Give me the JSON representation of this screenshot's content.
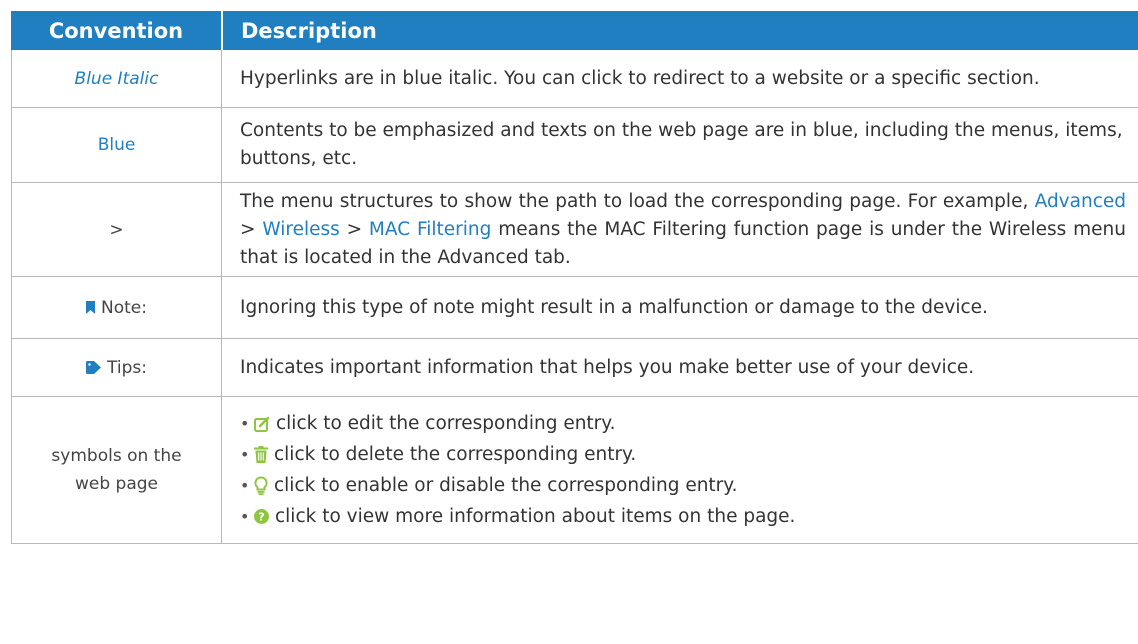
{
  "header": {
    "convention_label": "Convention",
    "description_label": "Description"
  },
  "rows": [
    {
      "convention": "Blue Italic",
      "description": "Hyperlinks are in blue italic. You can click to redirect to a website or a specific section."
    },
    {
      "convention": "Blue",
      "description": "Contents to be emphasized and texts on the web page are in blue, including the menus, items, buttons, etc."
    },
    {
      "convention": ">",
      "description_part1": "The menu structures to show the path to load the corresponding page. For example, ",
      "path_advanced": "Advanced",
      "sep1": " > ",
      "path_wireless": "Wireless",
      "sep2": " > ",
      "path_mac": "MAC Filtering",
      "description_part2": " means the MAC Filtering function page is under the Wireless menu that is located in the Advanced tab."
    },
    {
      "convention": "Note:",
      "description": "Ignoring this type of note might result in a malfunction or damage to the device."
    },
    {
      "convention": "Tips:",
      "description": "Indicates important information that helps you make better use of your device."
    },
    {
      "convention": "symbols on the web page",
      "items": [
        {
          "icon": "edit-icon",
          "text": "click to edit the corresponding entry."
        },
        {
          "icon": "trash-icon",
          "text": "click to delete the corresponding entry."
        },
        {
          "icon": "lightbulb-icon",
          "text": "click to enable or disable the corresponding entry."
        },
        {
          "icon": "help-icon",
          "text": "click to view more information about items on the page."
        }
      ]
    }
  ],
  "colors": {
    "header_bg": "#1f7fc0",
    "link_blue": "#1f7fc0",
    "icon_green": "#8dc63f",
    "border": "#b8b8b8"
  }
}
